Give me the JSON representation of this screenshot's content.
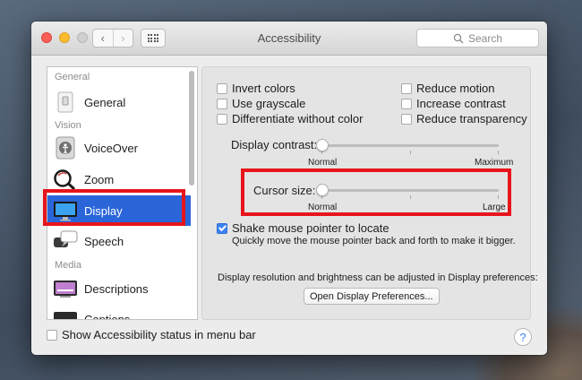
{
  "window": {
    "title": "Accessibility",
    "nav_back": "‹",
    "nav_forward": "›",
    "search_placeholder": "Search"
  },
  "sidebar": {
    "sections": [
      {
        "label": "General"
      },
      {
        "label": "Vision"
      },
      {
        "label": "Media"
      }
    ],
    "items": [
      {
        "label": "General",
        "icon": "switch-panel-icon"
      },
      {
        "label": "VoiceOver",
        "icon": "voiceover-speaker-icon"
      },
      {
        "label": "Zoom",
        "icon": "magnifier-icon"
      },
      {
        "label": "Display",
        "icon": "monitor-icon",
        "selected": true
      },
      {
        "label": "Speech",
        "icon": "speech-bubble-icon"
      },
      {
        "label": "Descriptions",
        "icon": "tv-descriptions-icon"
      },
      {
        "label": "Captions",
        "icon": "captions-icon"
      }
    ]
  },
  "display": {
    "options_left": [
      {
        "label": "Invert colors",
        "checked": false
      },
      {
        "label": "Use grayscale",
        "checked": false
      },
      {
        "label": "Differentiate without color",
        "checked": false
      }
    ],
    "options_right": [
      {
        "label": "Reduce motion",
        "checked": false
      },
      {
        "label": "Increase contrast",
        "checked": false
      },
      {
        "label": "Reduce transparency",
        "checked": false
      }
    ],
    "contrast": {
      "label": "Display contrast:",
      "min": "Normal",
      "max": "Maximum",
      "value": 0
    },
    "cursor": {
      "label": "Cursor size:",
      "min": "Normal",
      "max": "Large",
      "value": 0
    },
    "shake": {
      "label": "Shake mouse pointer to locate",
      "checked": true,
      "description": "Quickly move the mouse pointer back and forth to make it bigger."
    },
    "prefs_note": "Display resolution and brightness can be adjusted in Display preferences:",
    "prefs_button": "Open Display Preferences..."
  },
  "footer": {
    "status_label": "Show Accessibility status in menu bar",
    "status_checked": false,
    "help": "?"
  },
  "colors": {
    "highlight": "#e8141b",
    "selection": "#2a66d9",
    "checkbox_checked": "#3b82f0"
  }
}
